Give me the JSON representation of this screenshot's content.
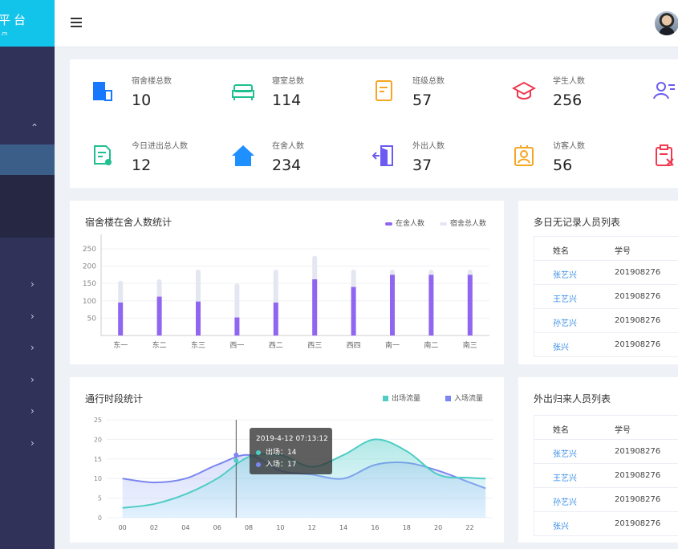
{
  "brand": {
    "title": "平台",
    "subtitle": "...m"
  },
  "colors": {
    "accent": "#12c3ea",
    "sidebar": "#30325a",
    "purple": "#9066f0",
    "teal": "#4ecdc4",
    "link": "#3a8ee6"
  },
  "stats": [
    {
      "label": "宿舍楼总数",
      "value": "10",
      "icon": "building-icon",
      "color": "#1677ff"
    },
    {
      "label": "寝室总数",
      "value": "114",
      "icon": "bed-icon",
      "color": "#1fbf8f"
    },
    {
      "label": "班级总数",
      "value": "57",
      "icon": "notebook-icon",
      "color": "#f5a623"
    },
    {
      "label": "学生人数",
      "value": "256",
      "icon": "graduation-cap-icon",
      "color": "#f0384f"
    },
    {
      "label": "",
      "value": "",
      "icon": "user-list-icon",
      "color": "#6b5bf2"
    },
    {
      "label": "今日进出总人数",
      "value": "12",
      "icon": "certificate-icon",
      "color": "#1fbf8f"
    },
    {
      "label": "在舍人数",
      "value": "234",
      "icon": "home-icon",
      "color": "#1e90ff"
    },
    {
      "label": "外出人数",
      "value": "37",
      "icon": "exit-door-icon",
      "color": "#6b5bf2"
    },
    {
      "label": "访客人数",
      "value": "56",
      "icon": "visitor-badge-icon",
      "color": "#f5a623"
    },
    {
      "label": "",
      "value": "",
      "icon": "clipboard-x-icon",
      "color": "#f0384f"
    }
  ],
  "bar_panel": {
    "title": "宿舍楼在舍人数统计",
    "legend": [
      "在舍人数",
      "宿舍总人数"
    ]
  },
  "line_panel": {
    "title": "通行时段统计",
    "legend": [
      "出场流量",
      "入场流量"
    ],
    "tooltip": {
      "time": "2019-4-12 07:13:12",
      "out": "出场：14",
      "in": "入场：17"
    }
  },
  "table1": {
    "title": "多日无记录人员列表",
    "headers": [
      "姓名",
      "学号"
    ],
    "rows": [
      [
        "张艺兴",
        "201908276"
      ],
      [
        "王艺兴",
        "201908276"
      ],
      [
        "孙艺兴",
        "201908276"
      ],
      [
        "张兴",
        "201908276"
      ]
    ]
  },
  "table2": {
    "title": "外出归来人员列表",
    "headers": [
      "姓名",
      "学号"
    ],
    "rows": [
      [
        "张艺兴",
        "201908276"
      ],
      [
        "王艺兴",
        "201908276"
      ],
      [
        "孙艺兴",
        "201908276"
      ],
      [
        "张兴",
        "201908276"
      ]
    ]
  },
  "chart_data": [
    {
      "type": "bar",
      "title": "宿舍楼在舍人数统计",
      "categories": [
        "东一",
        "东二",
        "东三",
        "西一",
        "西二",
        "西三",
        "西四",
        "南一",
        "南二",
        "南三"
      ],
      "series": [
        {
          "name": "在舍人数",
          "values": [
            95,
            112,
            98,
            52,
            95,
            162,
            140,
            175,
            175,
            175
          ]
        },
        {
          "name": "宿舍总人数",
          "values": [
            158,
            162,
            190,
            150,
            190,
            230,
            190,
            190,
            190,
            190
          ]
        }
      ],
      "yticks": [
        50,
        100,
        150,
        200,
        250
      ],
      "ylim": [
        0,
        280
      ],
      "legend": "top-right",
      "grid": true
    },
    {
      "type": "area",
      "title": "通行时段统计",
      "x": [
        0,
        2,
        4,
        6,
        8,
        10,
        12,
        14,
        16,
        18,
        20,
        22,
        23
      ],
      "xticks": [
        "00",
        "02",
        "04",
        "06",
        "08",
        "10",
        "12",
        "14",
        "16",
        "18",
        "20",
        "22"
      ],
      "series": [
        {
          "name": "出场流量",
          "values": [
            2.5,
            3.5,
            6,
            10,
            15.5,
            16,
            13,
            16,
            20,
            17,
            11,
            10.2,
            10
          ]
        },
        {
          "name": "入场流量",
          "values": [
            10,
            9,
            10,
            13.5,
            16,
            12,
            11,
            10,
            13.5,
            14,
            12,
            9,
            7.5
          ]
        }
      ],
      "yticks": [
        0,
        5,
        10,
        15,
        20,
        25
      ],
      "ylim": [
        0,
        25
      ],
      "xlim": [
        -1,
        23.5
      ],
      "legend": "top-right",
      "grid": true
    }
  ]
}
